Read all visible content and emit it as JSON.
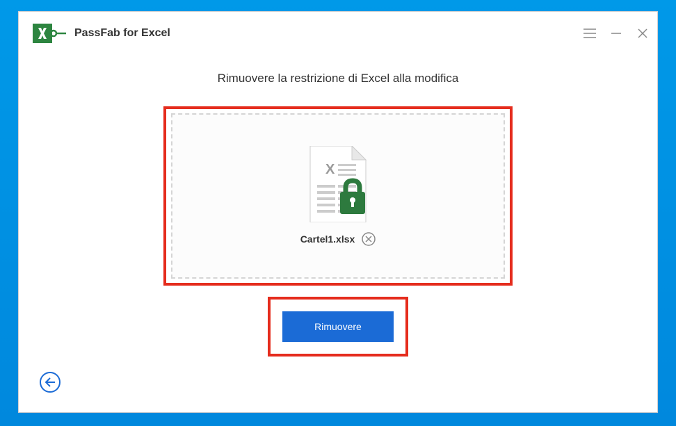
{
  "app": {
    "title": "PassFab for Excel"
  },
  "main": {
    "heading": "Rimuovere la restrizione di Excel alla modifica",
    "file_name": "Cartel1.xlsx",
    "button_label": "Rimuovere"
  }
}
